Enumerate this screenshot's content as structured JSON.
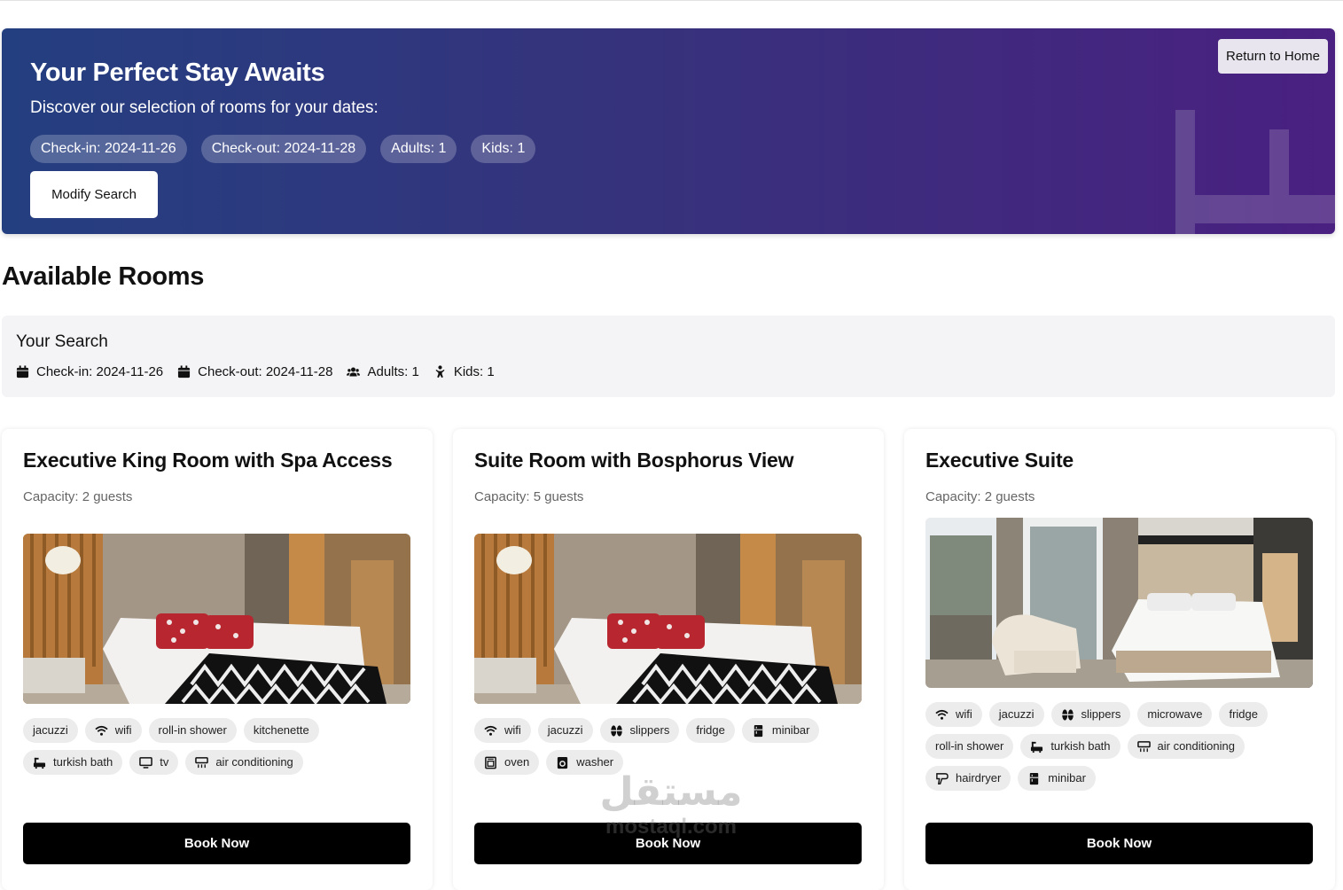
{
  "hero": {
    "title": "Your Perfect Stay Awaits",
    "subtitle": "Discover our selection of rooms for your dates:",
    "chips": [
      "Check-in: 2024-11-26",
      "Check-out: 2024-11-28",
      "Adults: 1",
      "Kids: 1"
    ],
    "modify_label": "Modify Search",
    "home_label": "Return to Home",
    "gradient_start": "#243f80",
    "gradient_end": "#4a2080"
  },
  "section_title": "Available Rooms",
  "summary": {
    "title": "Your Search",
    "items": [
      {
        "icon": "calendar-icon",
        "text": "Check-in: 2024-11-26"
      },
      {
        "icon": "calendar-icon",
        "text": "Check-out: 2024-11-28"
      },
      {
        "icon": "users-icon",
        "text": "Adults: 1"
      },
      {
        "icon": "child-icon",
        "text": "Kids: 1"
      }
    ]
  },
  "rooms": [
    {
      "title": "Executive King Room with Spa Access",
      "capacity": "Capacity: 2 guests",
      "image": "bedroom-photo-wood-panels",
      "amenities": [
        {
          "label": "jacuzzi",
          "icon": ""
        },
        {
          "label": "wifi",
          "icon": "wifi-icon"
        },
        {
          "label": "roll-in shower",
          "icon": ""
        },
        {
          "label": "kitchenette",
          "icon": ""
        },
        {
          "label": "turkish bath",
          "icon": "bath-icon"
        },
        {
          "label": "tv",
          "icon": "tv-icon"
        },
        {
          "label": "air conditioning",
          "icon": "ac-icon"
        }
      ],
      "book_label": "Book Now"
    },
    {
      "title": "Suite Room with Bosphorus View",
      "capacity": "Capacity: 5 guests",
      "image": "bedroom-photo-wood-panels",
      "amenities": [
        {
          "label": "wifi",
          "icon": "wifi-icon"
        },
        {
          "label": "jacuzzi",
          "icon": ""
        },
        {
          "label": "slippers",
          "icon": "slippers-icon"
        },
        {
          "label": "fridge",
          "icon": ""
        },
        {
          "label": "minibar",
          "icon": "minibar-icon"
        },
        {
          "label": "oven",
          "icon": "oven-icon"
        },
        {
          "label": "washer",
          "icon": "washer-icon"
        }
      ],
      "book_label": "Book Now"
    },
    {
      "title": "Executive Suite",
      "capacity": "Capacity: 2 guests",
      "image": "bedroom-photo-bright-windows",
      "amenities": [
        {
          "label": "wifi",
          "icon": "wifi-icon"
        },
        {
          "label": "jacuzzi",
          "icon": ""
        },
        {
          "label": "slippers",
          "icon": "slippers-icon"
        },
        {
          "label": "microwave",
          "icon": ""
        },
        {
          "label": "fridge",
          "icon": ""
        },
        {
          "label": "roll-in shower",
          "icon": ""
        },
        {
          "label": "turkish bath",
          "icon": "bath-icon"
        },
        {
          "label": "air conditioning",
          "icon": "ac-icon"
        },
        {
          "label": "hairdryer",
          "icon": "hairdryer-icon"
        },
        {
          "label": "minibar",
          "icon": "minibar-icon"
        }
      ],
      "book_label": "Book Now"
    }
  ],
  "watermark": {
    "arabic": "مستقل",
    "latin": "mostaql.com"
  }
}
